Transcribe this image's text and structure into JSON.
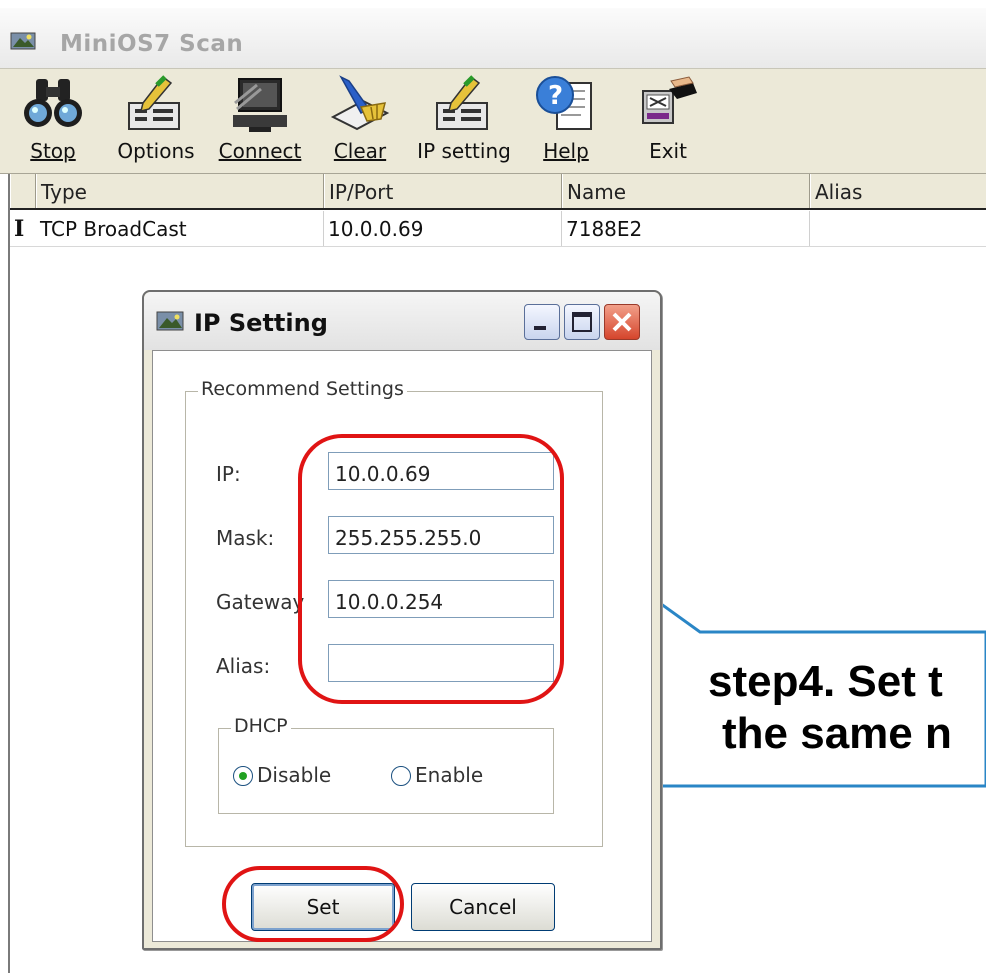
{
  "window": {
    "title": "MiniOS7 Scan"
  },
  "toolbar": {
    "buttons": [
      {
        "label": "Stop",
        "icon": "binoculars-icon"
      },
      {
        "label": "Options",
        "icon": "options-pen-icon"
      },
      {
        "label": "Connect",
        "icon": "computer-connect-icon"
      },
      {
        "label": "Clear",
        "icon": "broom-clear-icon"
      },
      {
        "label": "IP setting",
        "icon": "ip-setting-pen-icon"
      },
      {
        "label": "Help",
        "icon": "help-icon"
      },
      {
        "label": "Exit",
        "icon": "exit-hand-icon"
      }
    ]
  },
  "table": {
    "columns": [
      "Type",
      "IP/Port",
      "Name",
      "Alias"
    ],
    "rows": [
      {
        "type": "TCP BroadCast",
        "ip_port": "10.0.0.69",
        "name": "7188E2",
        "alias": ""
      }
    ],
    "row_marker": "I"
  },
  "dialog": {
    "title": "IP Setting",
    "group_title": "Recommend Settings",
    "fields": {
      "ip": {
        "label": "IP:",
        "value": "10.0.0.69"
      },
      "mask": {
        "label": "Mask:",
        "value": "255.255.255.0"
      },
      "gateway": {
        "label": "Gateway",
        "value": "10.0.0.254"
      },
      "alias": {
        "label": "Alias:",
        "value": ""
      }
    },
    "dhcp": {
      "title": "DHCP",
      "options": [
        {
          "label": "Disable",
          "checked": true
        },
        {
          "label": "Enable",
          "checked": false
        }
      ]
    },
    "buttons": {
      "set": "Set",
      "cancel": "Cancel"
    }
  },
  "annotation": {
    "line1": "step4. Set t",
    "line2": "the same n",
    "highlight_color": "#e01414",
    "callout_border_color": "#2a86c6"
  }
}
